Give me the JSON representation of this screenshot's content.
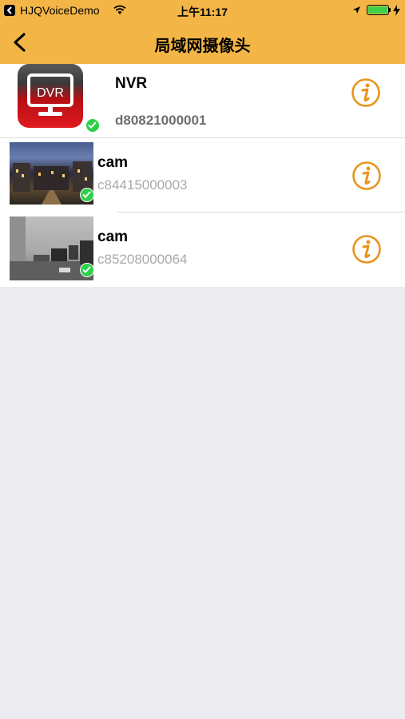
{
  "status_bar": {
    "app_name": "HJQVoiceDemo",
    "time": "上午11:17",
    "battery_level": 1.0
  },
  "nav": {
    "title": "局域网摄像头",
    "back_icon": "chevron-left-icon"
  },
  "devices": [
    {
      "name": "NVR",
      "uid": "d80821000001",
      "thumbnail": "dvr-icon",
      "online": true
    },
    {
      "name": "cam",
      "uid": "c84415000003",
      "thumbnail": "camera-snapshot",
      "online": true
    },
    {
      "name": "cam",
      "uid": "c85208000064",
      "thumbnail": "camera-snapshot",
      "online": true
    }
  ],
  "colors": {
    "accent": "#f3b646",
    "info_icon": "#e8941f",
    "online": "#2ed04a",
    "background": "#ebebf0"
  }
}
